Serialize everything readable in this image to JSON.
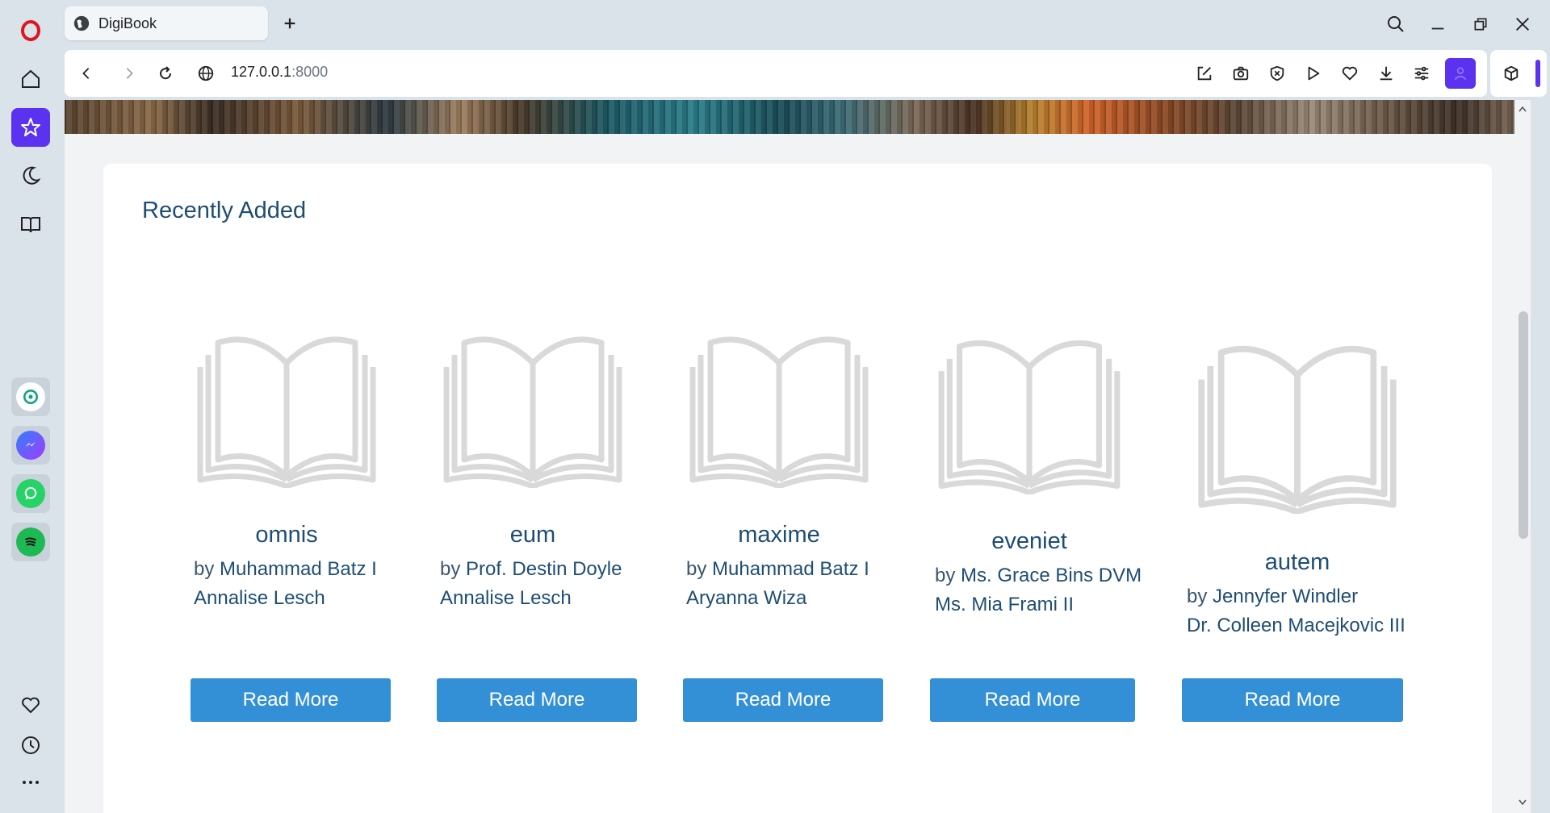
{
  "browser": {
    "tab_title": "DigiBook",
    "url_host": "127.0.0.1",
    "url_port": ":8000"
  },
  "page": {
    "section_title": "Recently Added",
    "books": [
      {
        "title": "omnis",
        "by": "by",
        "author1": "Muhammad Batz I",
        "author2": "Annalise Lesch",
        "button": "Read More"
      },
      {
        "title": "eum",
        "by": "by",
        "author1": "Prof. Destin Doyle",
        "author2": "Annalise Lesch",
        "button": "Read More"
      },
      {
        "title": "maxime",
        "by": "by",
        "author1": "Muhammad Batz I",
        "author2": "Aryanna Wiza",
        "button": "Read More"
      },
      {
        "title": "eveniet",
        "by": "by",
        "author1": "Ms. Grace Bins DVM",
        "author2": "Ms. Mia Frami II",
        "button": "Read More"
      },
      {
        "title": "autem",
        "by": "by",
        "author1": "Jennyfer Windler",
        "author2": "Dr. Colleen Macejkovic III",
        "button": "Read More"
      }
    ]
  },
  "colors": {
    "accent": "#5a32f0",
    "heading": "#1e4d74",
    "button": "#3390d6"
  }
}
